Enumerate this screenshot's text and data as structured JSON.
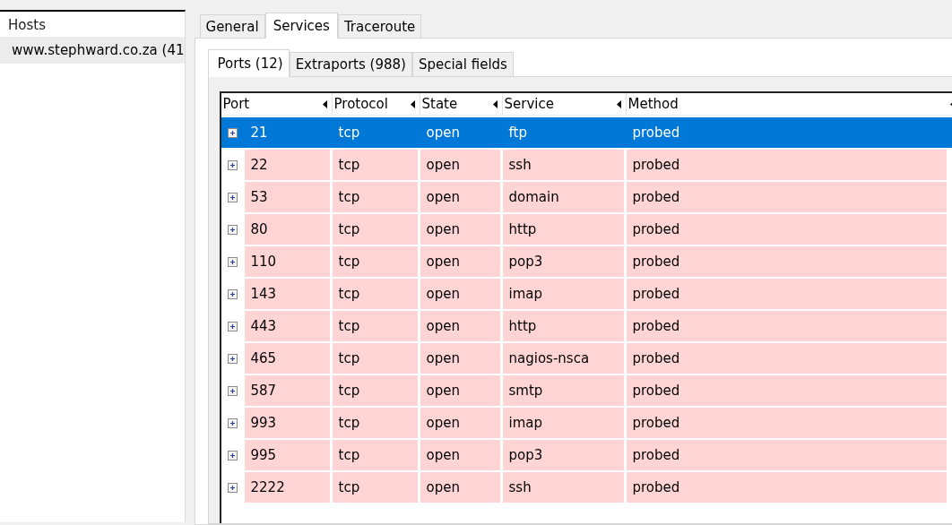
{
  "hosts_panel": {
    "header": "Hosts",
    "items": [
      {
        "label": "www.stephward.co.za (41",
        "selected": true
      }
    ]
  },
  "tabs": [
    {
      "label": "General",
      "selected": false
    },
    {
      "label": "Services",
      "selected": true
    },
    {
      "label": "Traceroute",
      "selected": false
    }
  ],
  "subtabs": [
    {
      "label": "Ports (12)",
      "selected": true
    },
    {
      "label": "Extraports (988)",
      "selected": false
    },
    {
      "label": "Special fields",
      "selected": false
    }
  ],
  "table": {
    "columns": [
      "Port",
      "Protocol",
      "State",
      "Service",
      "Method"
    ],
    "rows": [
      {
        "cells": [
          "21",
          "tcp",
          "open",
          "ftp",
          "probed"
        ],
        "selected": true
      },
      {
        "cells": [
          "22",
          "tcp",
          "open",
          "ssh",
          "probed"
        ],
        "selected": false
      },
      {
        "cells": [
          "53",
          "tcp",
          "open",
          "domain",
          "probed"
        ],
        "selected": false
      },
      {
        "cells": [
          "80",
          "tcp",
          "open",
          "http",
          "probed"
        ],
        "selected": false
      },
      {
        "cells": [
          "110",
          "tcp",
          "open",
          "pop3",
          "probed"
        ],
        "selected": false
      },
      {
        "cells": [
          "143",
          "tcp",
          "open",
          "imap",
          "probed"
        ],
        "selected": false
      },
      {
        "cells": [
          "443",
          "tcp",
          "open",
          "http",
          "probed"
        ],
        "selected": false
      },
      {
        "cells": [
          "465",
          "tcp",
          "open",
          "nagios-nsca",
          "probed"
        ],
        "selected": false
      },
      {
        "cells": [
          "587",
          "tcp",
          "open",
          "smtp",
          "probed"
        ],
        "selected": false
      },
      {
        "cells": [
          "993",
          "tcp",
          "open",
          "imap",
          "probed"
        ],
        "selected": false
      },
      {
        "cells": [
          "995",
          "tcp",
          "open",
          "pop3",
          "probed"
        ],
        "selected": false
      },
      {
        "cells": [
          "2222",
          "tcp",
          "open",
          "ssh",
          "probed"
        ],
        "selected": false
      }
    ]
  }
}
